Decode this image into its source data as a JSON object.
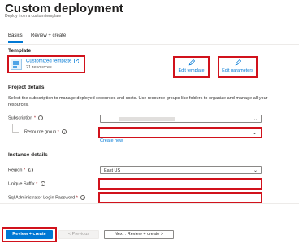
{
  "header": {
    "title": "Custom deployment",
    "more_label": "···",
    "subtitle": "Deploy from a custom template"
  },
  "tabs": [
    {
      "label": "Basics"
    },
    {
      "label": "Review + create"
    }
  ],
  "template": {
    "heading": "Template",
    "link_label": "Customized template",
    "resources_count": "21 resources",
    "edit_template_label": "Edit template",
    "edit_parameters_label": "Edit parameters"
  },
  "project": {
    "heading": "Project details",
    "description": "Select the subscription to manage deployed resources and costs. Use resource groups like folders to organize and manage all your resources.",
    "subscription_label": "Subscription",
    "resource_group_label": "Resource group",
    "resource_group_value": "",
    "create_new_label": "Create new"
  },
  "instance": {
    "heading": "Instance details",
    "region_label": "Region",
    "region_value": "East US",
    "unique_suffix_label": "Unique Suffix",
    "unique_suffix_value": "",
    "sql_label": "Sql Administrator Login Password",
    "sql_value": ""
  },
  "footer": {
    "review_create_label": "Review + create",
    "previous_label": "< Previous",
    "next_label": "Next : Review + create >"
  },
  "colors": {
    "accent": "#0078d4",
    "highlight_box": "#d1121c",
    "required": "#a4262c"
  }
}
